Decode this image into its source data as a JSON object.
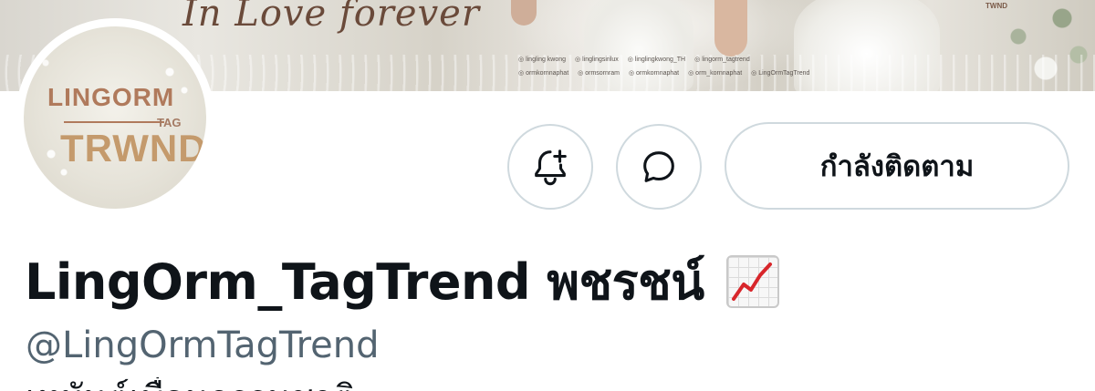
{
  "banner": {
    "script_text": "In Love forever",
    "corner_logo": "TWND",
    "credits": [
      [
        "lingling kwong",
        "linglingsirilux",
        "linglingkwong_TH",
        "lingorm_tagtrend"
      ],
      [
        "ormkornnaphat",
        "ormsornram",
        "ormkornnaphat",
        "orm_kornnaphat",
        "LingOrmTagTrend"
      ]
    ]
  },
  "avatar": {
    "logo_top": "LINGORM",
    "logo_tag": "TAG",
    "logo_bottom": "TRWND"
  },
  "actions": {
    "notify_icon": "bell-plus-icon",
    "message_icon": "message-bubble-icon",
    "follow_label": "กำลังติดตาม"
  },
  "profile": {
    "display_name": "LingOrm_TagTrend พชรชน์",
    "name_emoji": "chart-increasing-icon",
    "handle": "@LingOrmTagTrend",
    "bio_partial": "เหมันต์เพื่อนธรรมชาติ"
  },
  "colors": {
    "border": "#cfd9de",
    "text": "#0f1419",
    "secondary_text": "#536471",
    "chart_red": "#d8262b"
  }
}
